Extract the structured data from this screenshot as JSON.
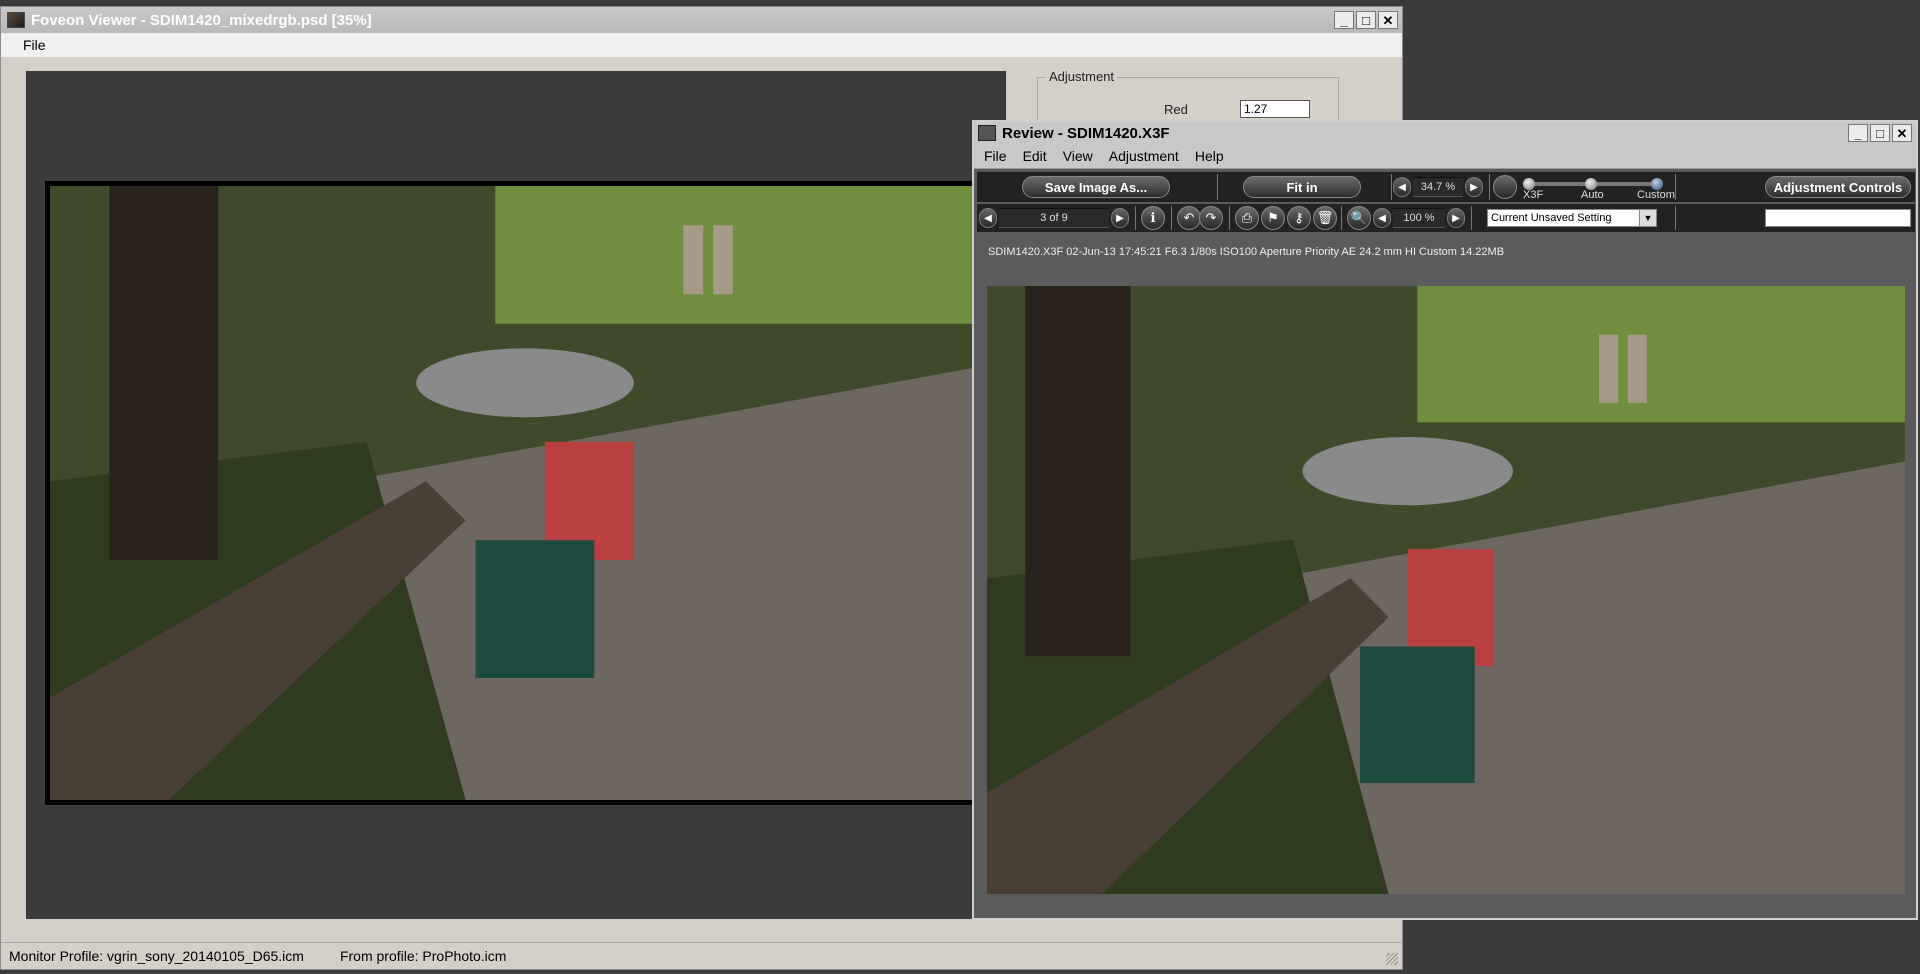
{
  "foveon_window": {
    "title": "Foveon Viewer - SDIM1420_mixedrgb.psd [35%]",
    "menu": [
      "File"
    ],
    "adjustment": {
      "legend": "Adjustment",
      "red_label": "Red",
      "red_value": "1.27"
    },
    "status": {
      "monitor_profile": "Monitor Profile:  vgrin_sony_20140105_D65.icm",
      "from_profile": "From profile:  ProPhoto.icm"
    }
  },
  "review_window": {
    "title": "Review - SDIM1420.X3F",
    "menu": [
      "File",
      "Edit",
      "View",
      "Adjustment",
      "Help"
    ],
    "toolbar": {
      "save_label": "Save Image As...",
      "fit_label": "Fit in",
      "zoom_value": "34.7 %",
      "page_counter": "3 of 9",
      "second_zoom_value": "100 %",
      "x3f_label": "X3F",
      "auto_label": "Auto",
      "custom_label": "Custom",
      "adjustment_controls_label": "Adjustment Controls",
      "setting_select": "Current Unsaved Setting"
    },
    "info_line": "SDIM1420.X3F 02-Jun-13 17:45:21 F6.3 1/80s ISO100 Aperture Priority AE 24.2 mm HI Custom 14.22MB"
  },
  "title_buttons": {
    "minimize": "_",
    "maximize": "□",
    "close": "✕"
  },
  "icons": {
    "info": "ℹ",
    "rotate_left": "↶",
    "rotate_right": "↷",
    "print": "⎙",
    "flag": "⚑",
    "key": "⚷",
    "trash": "🗑",
    "zoom": "🔍",
    "prev": "◀",
    "next": "▶",
    "dropdown": "▼"
  }
}
